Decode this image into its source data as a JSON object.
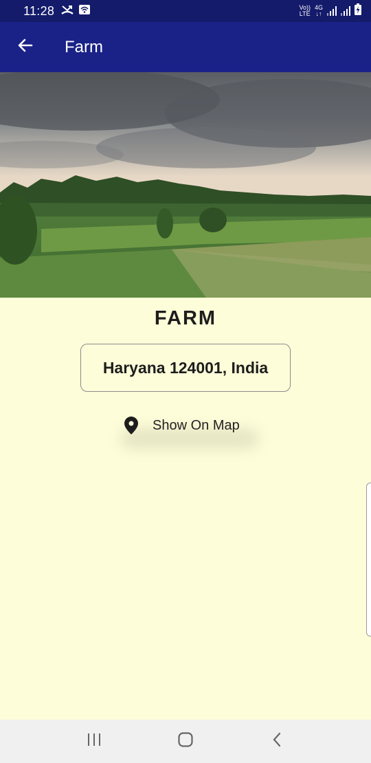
{
  "status_bar": {
    "time": "11:28",
    "network_top": "Vo))",
    "network_bottom": "LTE",
    "data_top": "4G",
    "data_bottom": "↓↑",
    "icons": [
      "missed-call-icon",
      "wifi-icon",
      "signal-icon",
      "signal-icon",
      "battery-charging-icon"
    ]
  },
  "app_bar": {
    "title": "Farm",
    "back_icon": "arrow-left-icon"
  },
  "content": {
    "farm_name": "FARM",
    "address": "Haryana 124001, India",
    "map_button_label": "Show On Map",
    "map_icon": "location-pin-icon"
  },
  "nav_bar": {
    "items": [
      "recent-apps-icon",
      "home-icon",
      "back-chevron-icon"
    ]
  },
  "colors": {
    "status_bar": "#141b6b",
    "app_bar": "#1a2288",
    "background": "#fefdd9",
    "nav_bar": "#f0f0f0"
  }
}
